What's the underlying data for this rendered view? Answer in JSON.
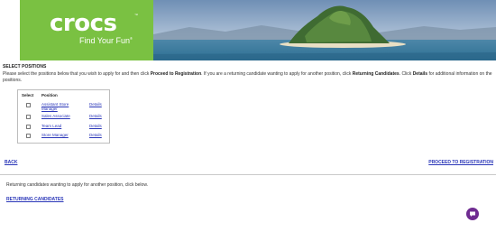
{
  "header": {
    "brand_name": "crocs",
    "tm": "™",
    "tagline": "Find Your Fun",
    "registered": "®",
    "photo": "tropical-island-photo",
    "brand_color": "#7ac142"
  },
  "section_title": "SELECT POSITIONS",
  "instructions": {
    "part1": "Please select the positions below that you wish to apply for and then click ",
    "bold1": "Proceed to Registration",
    "part2": ". If you are a returning candidate wanting to apply for another position, click ",
    "bold2": "Returning Candidates",
    "part3": ". Click ",
    "bold3": "Details",
    "part4": " for additional information on the positions."
  },
  "positions_table": {
    "col_select": "Select",
    "col_position": "Position",
    "rows": [
      {
        "title": "Assistant Store Manager",
        "details": "Details",
        "checked": false
      },
      {
        "title": "Sales Associate",
        "details": "Details",
        "checked": false
      },
      {
        "title": "Team Lead",
        "details": "Details",
        "checked": false
      },
      {
        "title": "Store Manager",
        "details": "Details",
        "checked": false
      }
    ]
  },
  "nav": {
    "back": "BACK",
    "proceed": "PROCEED TO REGISTRATION"
  },
  "returning": {
    "text": "Returning candidates wanting to apply for another position, click below.",
    "link": "RETURNING CANDIDATES"
  },
  "chat": {
    "icon": "chat-bubble-icon",
    "color": "#6f2c91"
  },
  "colors": {
    "link": "#2a36b8",
    "divider": "#c9c9c9"
  }
}
